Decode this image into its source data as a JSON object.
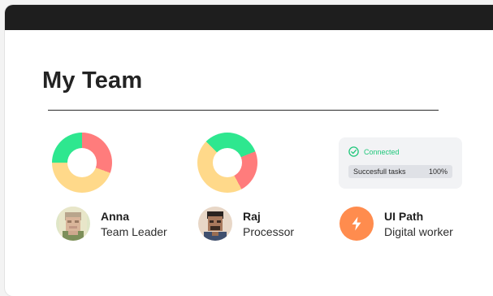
{
  "title": "My Team",
  "status": {
    "connected_label": "Connected",
    "task_label": "Succesfull tasks",
    "task_value": "100%",
    "check_icon": "check-circle-icon"
  },
  "members": [
    {
      "name": "Anna",
      "role": "Team Leader"
    },
    {
      "name": "Raj",
      "role": "Processor"
    },
    {
      "name": "UI Path",
      "role": "Digital worker",
      "icon": "lightning-icon"
    }
  ],
  "colors": {
    "green": "#2ee78f",
    "red": "#ff7c7c",
    "yellow": "#ffd98a",
    "orange": "#ff8c4e",
    "connected": "#1fc77a"
  }
}
